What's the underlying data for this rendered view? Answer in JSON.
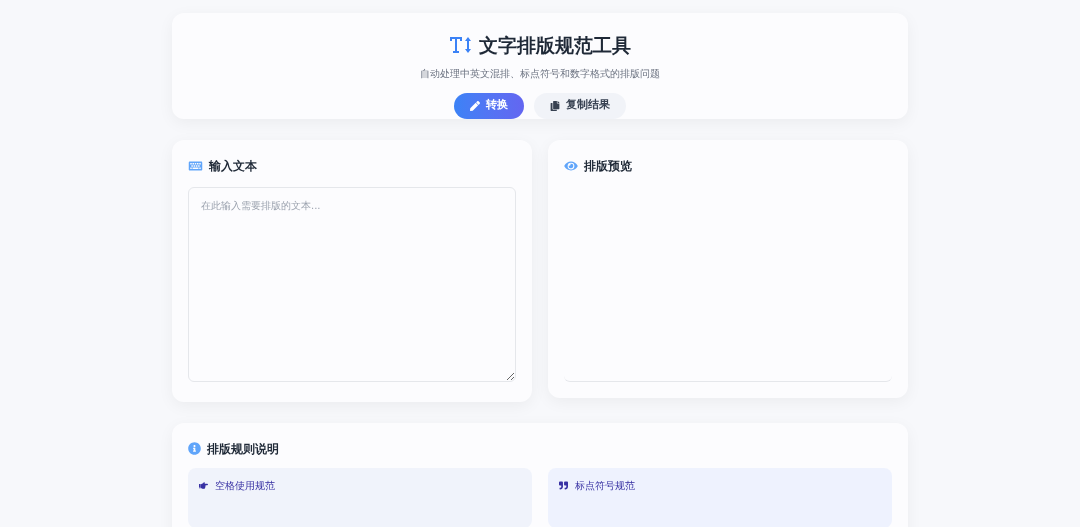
{
  "header": {
    "title": "文字排版规范工具",
    "subtitle": "自动处理中英文混排、标点符号和数字格式的排版问题"
  },
  "buttons": [
    {
      "label": "转换",
      "kind": "primary"
    },
    {
      "label": "复制结果",
      "kind": "secondary"
    }
  ],
  "input_panel": {
    "title": "输入文本",
    "placeholder": "在此输入需要排版的文本..."
  },
  "preview_panel": {
    "title": "排版预览"
  },
  "rules": {
    "title": "排版规则说明",
    "items": [
      {
        "title": "空格使用规范",
        "kind": "spacing"
      },
      {
        "title": "标点符号规范",
        "kind": "punctuation"
      }
    ]
  }
}
